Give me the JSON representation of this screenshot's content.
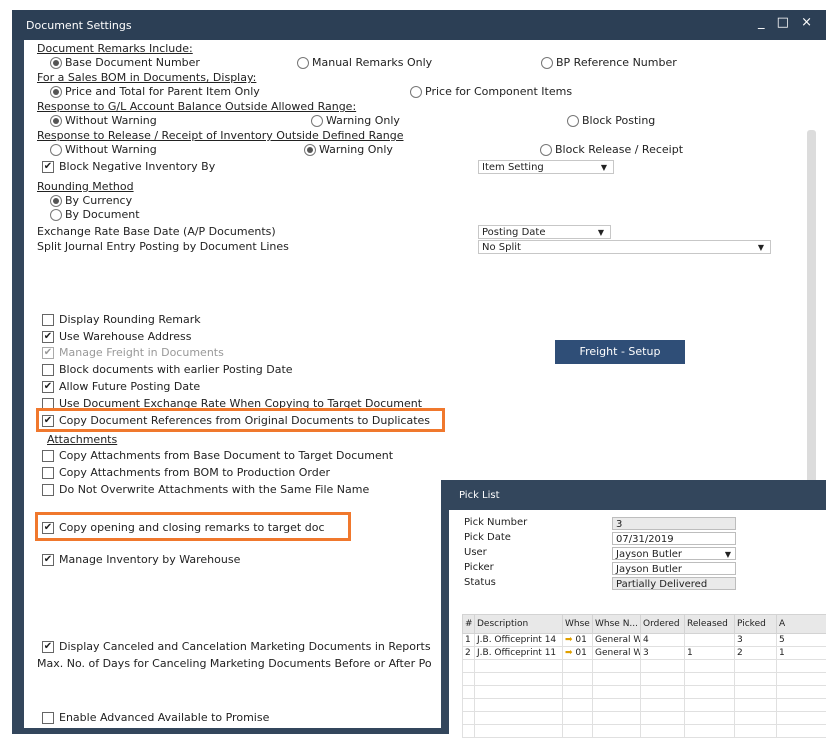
{
  "window": {
    "title": "Document Settings",
    "controls": "_ □ ×"
  },
  "remarks": {
    "heading": "Document Remarks Include:",
    "options": [
      "Base Document Number",
      "Manual Remarks Only",
      "BP Reference Number"
    ]
  },
  "bom": {
    "heading": "For a Sales BOM in Documents, Display:",
    "options": [
      "Price and Total for Parent Item Only",
      "Price for Component Items"
    ]
  },
  "gl": {
    "heading": "Response to G/L Account Balance Outside Allowed Range:",
    "options": [
      "Without Warning",
      "Warning Only",
      "Block Posting"
    ]
  },
  "release": {
    "heading": "Response to Release / Receipt of Inventory Outside Defined Range",
    "options": [
      "Without Warning",
      "Warning Only",
      "Block Release / Receipt"
    ]
  },
  "block_negative": {
    "label": "Block Negative Inventory By",
    "value": "Item Setting"
  },
  "rounding": {
    "heading": "Rounding Method",
    "options": [
      "By Currency",
      "By Document"
    ]
  },
  "exchange_rate": {
    "label": "Exchange Rate Base Date (A/P Documents)",
    "value": "Posting Date"
  },
  "split_journal": {
    "label": "Split Journal Entry Posting by Document Lines",
    "value": "No Split"
  },
  "checks": {
    "display_rounding": "Display Rounding Remark",
    "use_warehouse_address": "Use Warehouse Address",
    "manage_freight": "Manage Freight in Documents",
    "block_earlier": "Block documents with earlier Posting Date",
    "allow_future": "Allow Future Posting Date",
    "use_exchange_rate": "Use Document Exchange Rate When Copying to Target Document",
    "copy_references": "Copy Document References from Original Documents to Duplicates"
  },
  "freight_button": "Freight - Setup",
  "attachments": {
    "heading": "Attachments",
    "items": [
      "Copy Attachments from Base Document to Target Document",
      "Copy Attachments from BOM to Production Order",
      "Do Not Overwrite Attachments with the Same File Name"
    ]
  },
  "copy_remarks": "Copy opening and closing remarks to target doc",
  "manage_inventory": "Manage Inventory by Warehouse",
  "display_canceled": "Display Canceled and Cancelation Marketing Documents in Reports",
  "max_days": "Max. No. of Days for Canceling Marketing Documents Before or After Po",
  "enable_atp": "Enable Advanced Available to Promise",
  "pick_list": {
    "title": "Pick List",
    "fields": [
      {
        "label": "Pick Number",
        "value": "3"
      },
      {
        "label": "Pick Date",
        "value": "07/31/2019"
      },
      {
        "label": "User",
        "value": "Jayson Butler"
      },
      {
        "label": "Picker",
        "value": "Jayson Butler"
      },
      {
        "label": "Status",
        "value": "Partially Delivered"
      }
    ],
    "columns": [
      "#",
      "Description",
      "Whse",
      "Whse N...",
      "Ordered",
      "Released",
      "Picked",
      "A"
    ],
    "rows": [
      {
        "num": "1",
        "desc": "J.B. Officeprint 14",
        "whse": "01",
        "whse_name": "General Wa",
        "ordered": "4",
        "released": "",
        "picked": "3",
        "a": "5"
      },
      {
        "num": "2",
        "desc": "J.B. Officeprint 11",
        "whse": "01",
        "whse_name": "General Wa",
        "ordered": "3",
        "released": "1",
        "picked": "2",
        "a": "1"
      }
    ]
  },
  "colors": {
    "frame": "#33465c",
    "accent": "#f0782d",
    "button": "#2f4e77"
  }
}
